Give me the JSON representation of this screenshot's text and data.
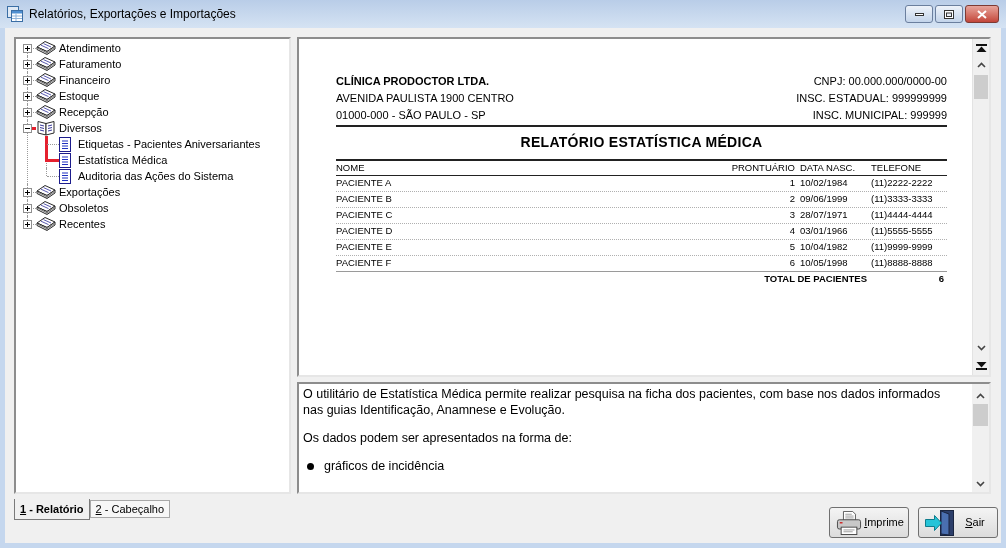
{
  "window": {
    "title": "Relatórios, Exportações e Importações"
  },
  "tree": [
    {
      "label": "Atendimento",
      "expanded": false,
      "selected": false
    },
    {
      "label": "Faturamento",
      "expanded": false,
      "selected": false
    },
    {
      "label": "Financeiro",
      "expanded": false,
      "selected": false
    },
    {
      "label": "Estoque",
      "expanded": false,
      "selected": false
    },
    {
      "label": "Recepção",
      "expanded": false,
      "selected": false
    },
    {
      "label": "Diversos",
      "expanded": true,
      "selected": false,
      "children": [
        {
          "label": "Etiquetas - Pacientes Aniversariantes",
          "selected": false
        },
        {
          "label": "Estatística Médica",
          "selected": true
        },
        {
          "label": "Auditoria das Ações do Sistema",
          "selected": false
        }
      ]
    },
    {
      "label": "Exportações",
      "expanded": false,
      "selected": false
    },
    {
      "label": "Obsoletos",
      "expanded": false,
      "selected": false
    },
    {
      "label": "Recentes",
      "expanded": false,
      "selected": false
    }
  ],
  "report": {
    "company": {
      "name": "CLÍNICA PRODOCTOR LTDA.",
      "address": "AVENIDA PAULISTA 1900 CENTRO",
      "city": "01000-000 - SÃO PAULO - SP"
    },
    "registrations": [
      "CNPJ: 00.000.000/0000-00",
      "INSC. ESTADUAL: 999999999",
      "INSC. MUNICIPAL: 999999"
    ],
    "title": "RELATÓRIO ESTATÍSTICA MÉDICA",
    "columns": [
      "NOME",
      "PRONTUÁRIO",
      "DATA NASC.",
      "TELEFONE"
    ],
    "rows": [
      [
        "PACIENTE A",
        "1",
        "10/02/1984",
        "(11)2222-2222"
      ],
      [
        "PACIENTE B",
        "2",
        "09/06/1999",
        "(11)3333-3333"
      ],
      [
        "PACIENTE C",
        "3",
        "28/07/1971",
        "(11)4444-4444"
      ],
      [
        "PACIENTE D",
        "4",
        "03/01/1966",
        "(11)5555-5555"
      ],
      [
        "PACIENTE E",
        "5",
        "10/04/1982",
        "(11)9999-9999"
      ],
      [
        "PACIENTE F",
        "6",
        "10/05/1998",
        "(11)8888-8888"
      ]
    ],
    "total": {
      "label": "TOTAL DE PACIENTES",
      "value": "6"
    }
  },
  "help": {
    "blocks": [
      {
        "kind": "paragraph",
        "text": "O utilitário de Estatística Médica permite realizar pesquisa na ficha dos pacientes, com base nos dados informados nas guias Identificação, Anamnese e Evolução."
      },
      {
        "kind": "paragraph",
        "text": "Os dados podem ser apresentados na forma de:"
      },
      {
        "kind": "bullet",
        "text": "gráficos de incidência"
      }
    ]
  },
  "tabs": [
    {
      "label": "1 - Relatório",
      "selected": true
    },
    {
      "label": "2 - Cabeçalho",
      "selected": false
    }
  ],
  "buttons": [
    {
      "kind": "print",
      "label": "Imprime"
    },
    {
      "kind": "exit",
      "label": "Sair"
    }
  ]
}
